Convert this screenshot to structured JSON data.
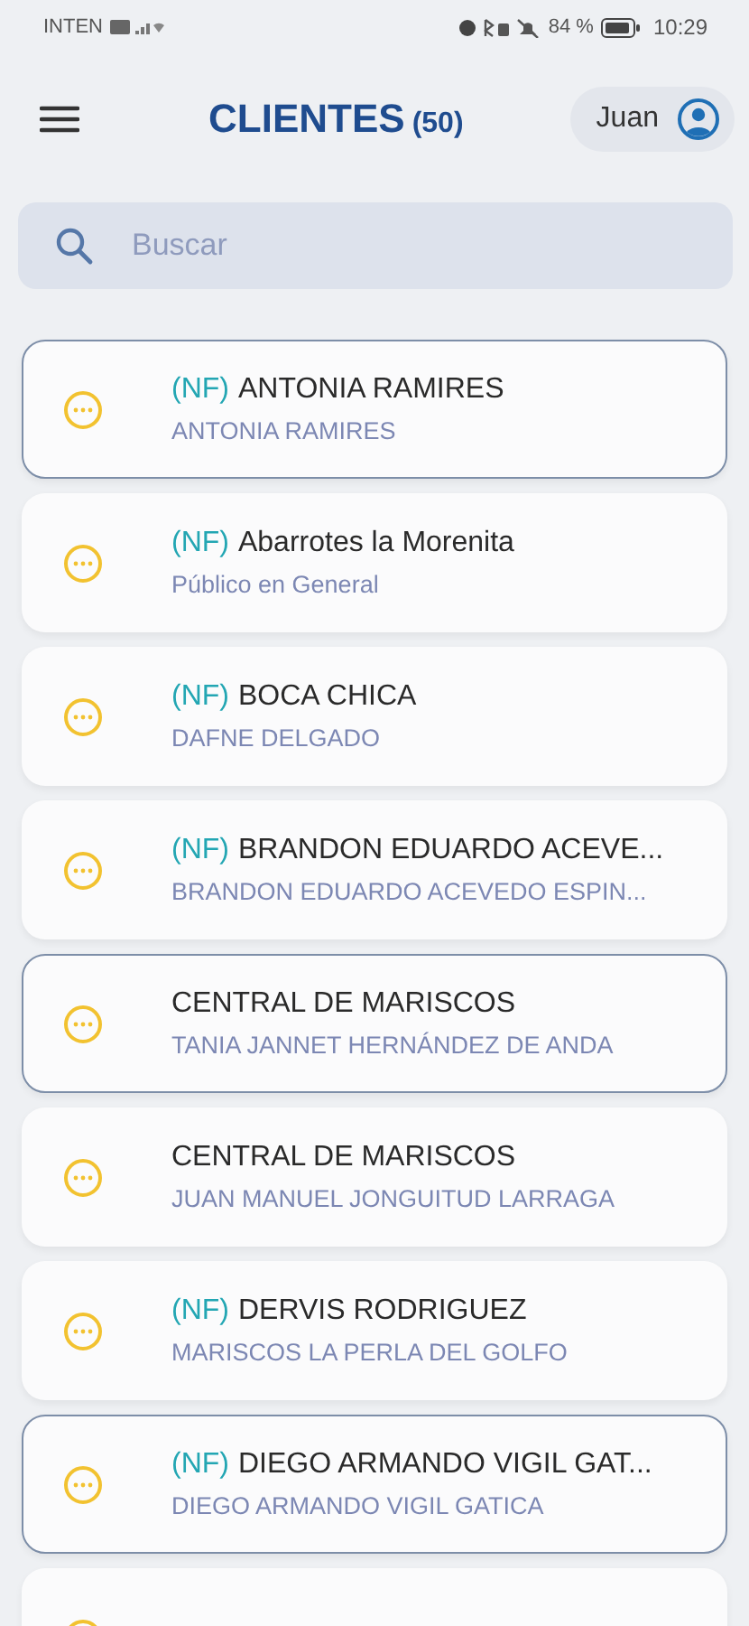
{
  "status_bar": {
    "carrier": "INTEN",
    "battery": "84 %",
    "time": "10:29"
  },
  "header": {
    "title": "CLIENTES",
    "count": "(50)",
    "user": "Juan"
  },
  "search": {
    "placeholder": "Buscar"
  },
  "clients": [
    {
      "tag": "(NF)",
      "name": "ANTONIA RAMIRES",
      "contact": "ANTONIA RAMIRES",
      "outlined": true
    },
    {
      "tag": "(NF)",
      "name": "Abarrotes la Morenita",
      "contact": "Público en General",
      "outlined": false
    },
    {
      "tag": "(NF)",
      "name": "BOCA CHICA",
      "contact": "DAFNE DELGADO",
      "outlined": false
    },
    {
      "tag": "(NF)",
      "name": "BRANDON EDUARDO ACEVE...",
      "contact": "BRANDON EDUARDO ACEVEDO ESPIN...",
      "outlined": false
    },
    {
      "name": "CENTRAL DE MARISCOS",
      "contact": "TANIA JANNET HERNÁNDEZ DE ANDA",
      "outlined": true
    },
    {
      "name": "CENTRAL DE MARISCOS",
      "contact": "JUAN MANUEL JONGUITUD LARRAGA",
      "outlined": false
    },
    {
      "tag": "(NF)",
      "name": "DERVIS RODRIGUEZ",
      "contact": "MARISCOS LA PERLA DEL GOLFO",
      "outlined": false
    },
    {
      "tag": "(NF)",
      "name": "DIEGO ARMANDO VIGIL GAT...",
      "contact": "DIEGO ARMANDO VIGIL GATICA",
      "outlined": true
    },
    {
      "outlined": false
    }
  ]
}
